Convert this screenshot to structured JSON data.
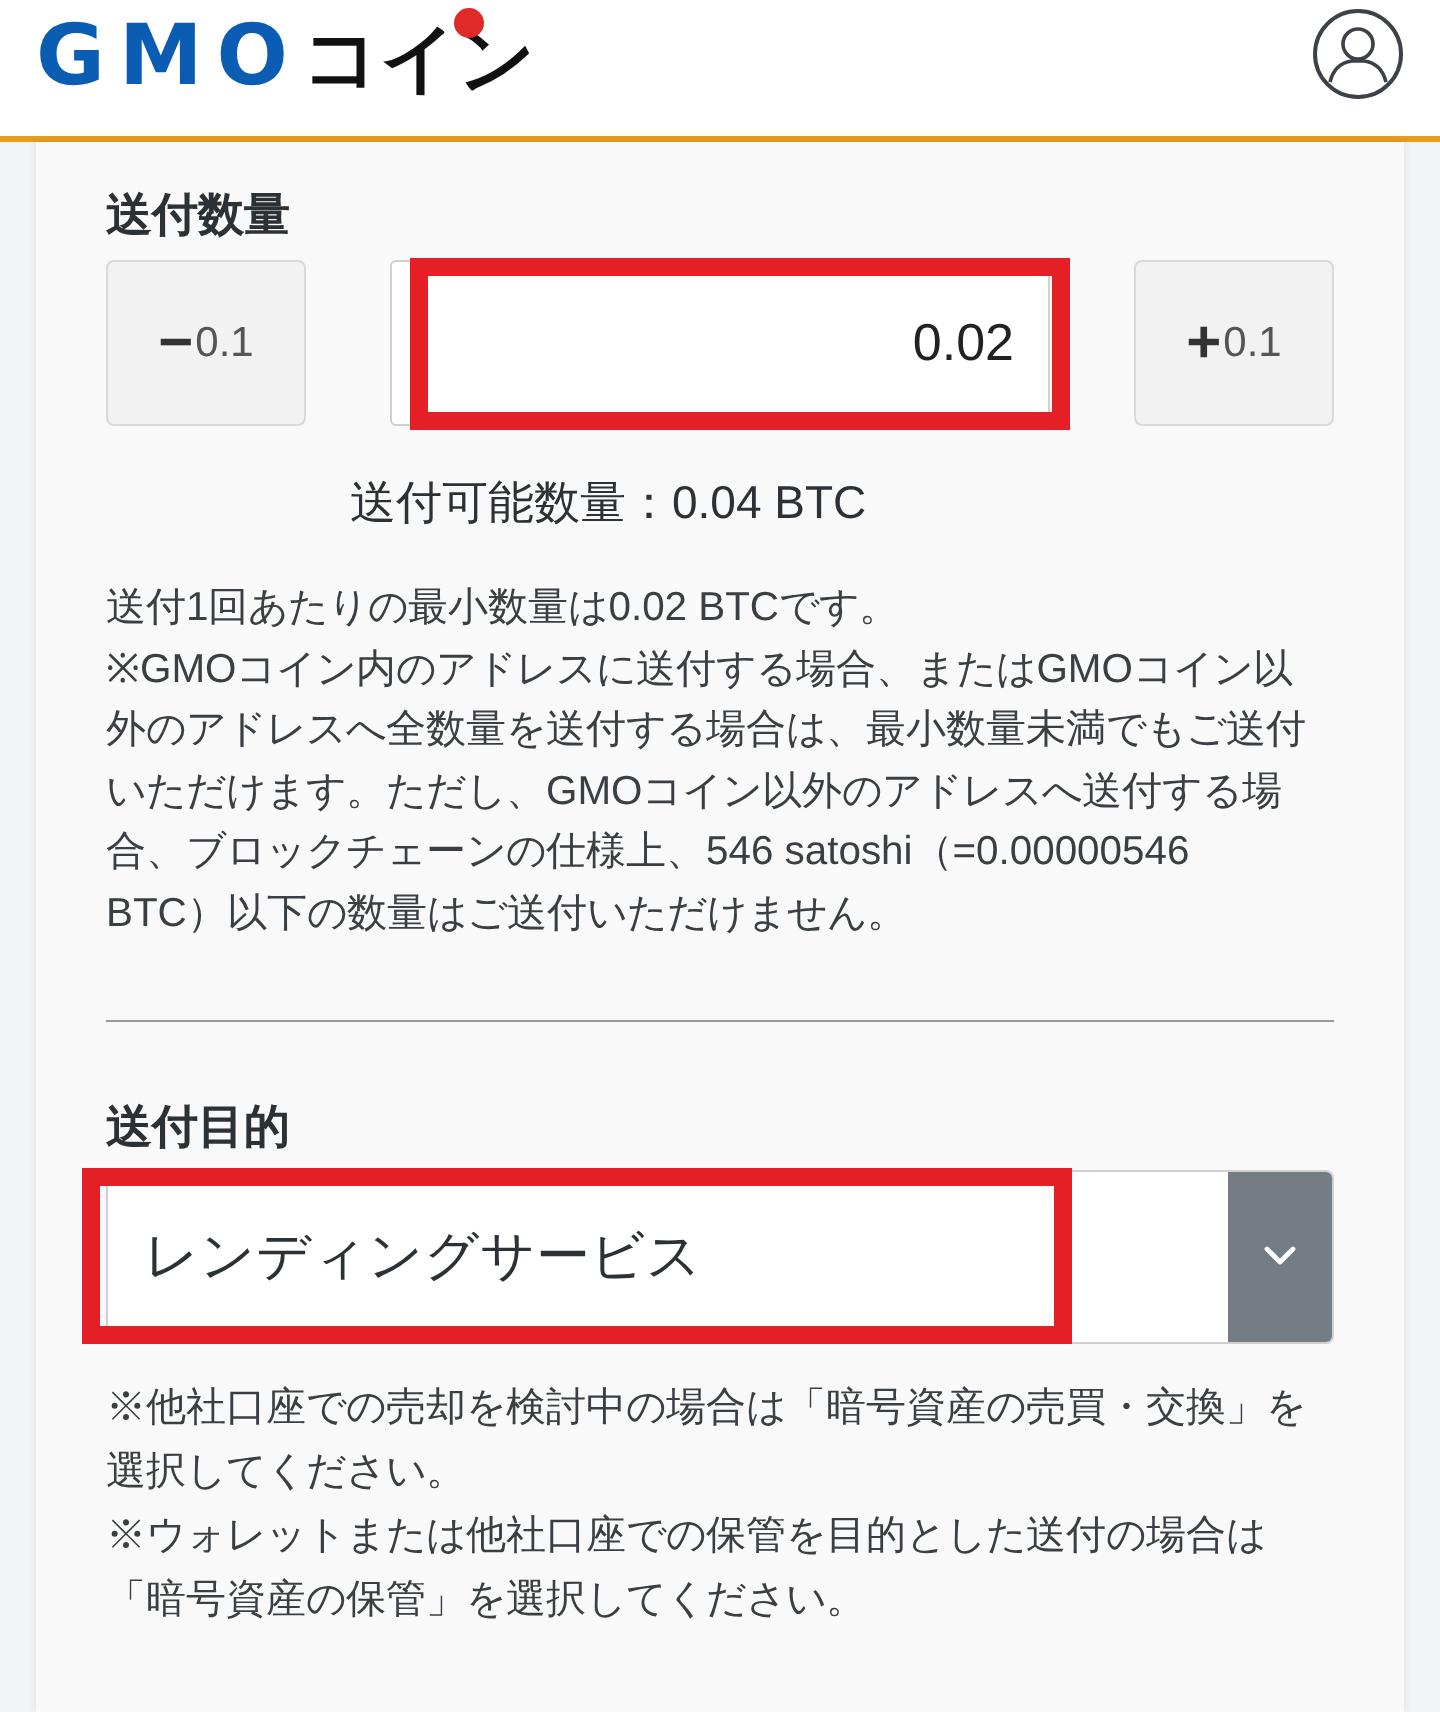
{
  "header": {
    "logo": {
      "letters": "GMO",
      "kana": "コイン"
    }
  },
  "amount": {
    "label": "送付数量",
    "decrease": {
      "sign": "−",
      "step": "0.1"
    },
    "value": "0.02",
    "highlighted": true,
    "increase": {
      "sign": "+",
      "step": "0.1"
    },
    "available": "送付可能数量：0.04 BTC",
    "notes": [
      "送付1回あたりの最小数量は0.02 BTCです。",
      "※GMOコイン内のアドレスに送付する場合、またはGMOコイン以外のアドレスへ全数量を送付する場合は、最小数量未満でもご送付いただけます。ただし、GMOコイン以外のアドレスへ送付する場合、ブロックチェーンの仕様上、546 satoshi（=0.00000546 BTC）以下の数量はご送付いただけません。"
    ]
  },
  "purpose": {
    "label": "送付目的",
    "value": "レンディングサービス",
    "highlighted": true,
    "notes": [
      "※他社口座での売却を検討中の場合は「暗号資産の売買・交換」を選択してください。",
      "※ウォレットまたは他社口座での保管を目的とした送付の場合は「暗号資産の保管」を選択してください。"
    ]
  }
}
